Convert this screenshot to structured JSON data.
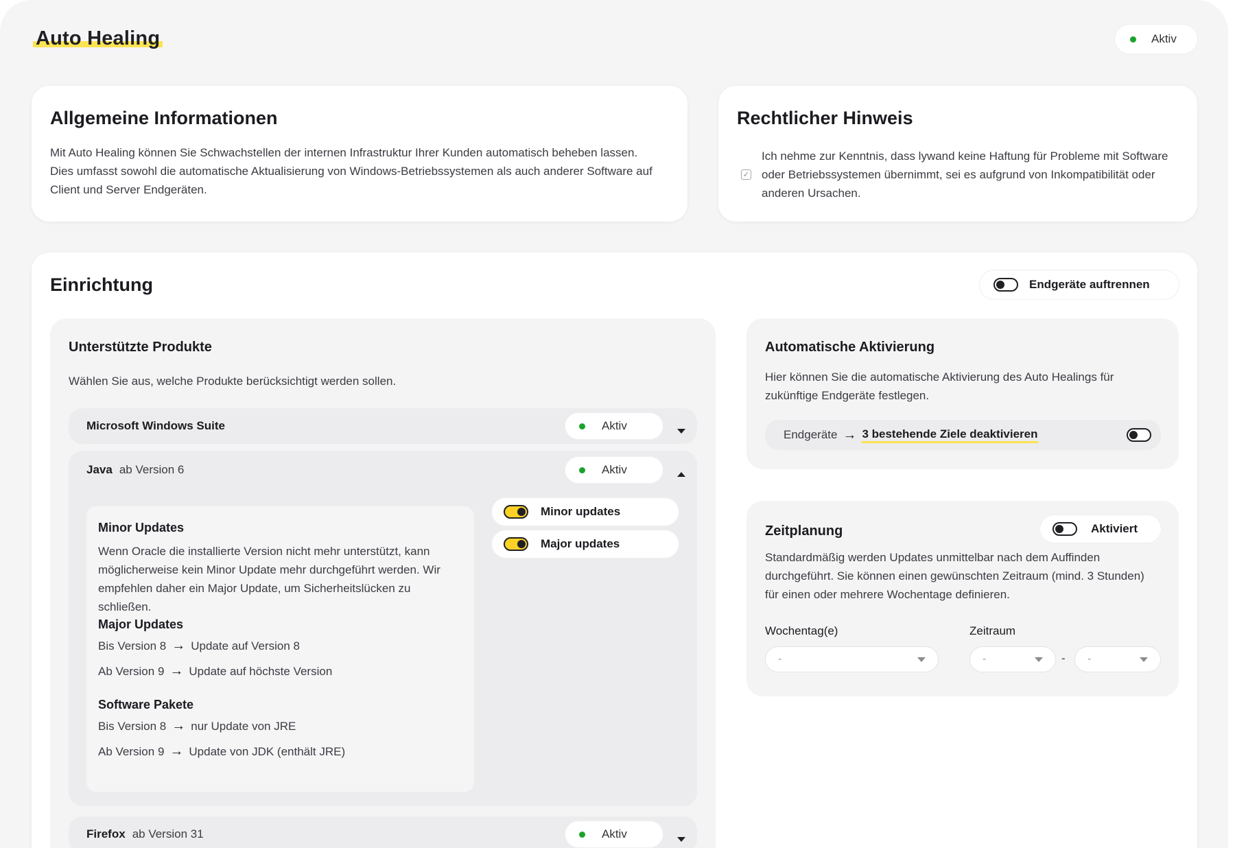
{
  "app": {
    "title": "Auto Healing",
    "status": "Aktiv",
    "status_color": "#1aa32c",
    "accent": "#fbd126"
  },
  "general": {
    "title": "Allgemeine Informationen",
    "text": "Mit Auto Healing können Sie Schwachstellen der internen Infrastruktur Ihrer Kunden automatisch beheben lassen. Dies umfasst sowohl die automatische Aktualisierung von Windows-Betriebssystemen als auch anderer Software auf Client und Server Endgeräten."
  },
  "legal": {
    "title": "Rechtlicher Hinweis",
    "checkbox_checked": true,
    "text": "Ich nehme zur Kenntnis, dass lywand keine Haftung für Probleme mit Software oder Betriebssystemen übernimmt, sei es aufgrund von Inkompatibilität oder anderen Ursachen."
  },
  "setup": {
    "title": "Einrichtung",
    "split_toggle_label": "Endgeräte auftrennen",
    "split_toggle_on": false
  },
  "products": {
    "title": "Unterstützte Produkte",
    "subtitle": "Wählen Sie aus, welche Produkte berücksichtigt werden sollen.",
    "items": [
      {
        "name": "Microsoft Windows Suite",
        "version": "",
        "status": "Aktiv",
        "expanded": false
      },
      {
        "name": "Java",
        "version": "ab Version 6",
        "status": "Aktiv",
        "expanded": true
      },
      {
        "name": "Firefox",
        "version": "ab Version 31",
        "status": "Aktiv",
        "expanded": false
      }
    ],
    "java_detail": {
      "minor_title": "Minor Updates",
      "minor_text": "Wenn Oracle die installierte Version nicht mehr unterstützt, kann möglicherweise kein Minor Update mehr durchgeführt werden. Wir empfehlen daher ein Major Update, um Sicherheitslücken zu schließen.",
      "major_title": "Major Updates",
      "major_lines": [
        {
          "from": "Bis Version 8",
          "to": "Update auf Version 8"
        },
        {
          "from": "Ab Version 9",
          "to": "Update auf höchste Version"
        }
      ],
      "packages_title": "Software Pakete",
      "package_lines": [
        {
          "from": "Bis Version 8",
          "to": "nur Update von JRE"
        },
        {
          "from": "Ab Version 9",
          "to": "Update von JDK (enthält JRE)"
        }
      ],
      "toggles": [
        {
          "label": "Minor updates",
          "on": true
        },
        {
          "label": "Major updates",
          "on": true
        }
      ]
    }
  },
  "auto_activation": {
    "title": "Automatische Aktivierung",
    "text": "Hier können Sie die automatische Aktivierung des Auto Healings für zukünftige Endgeräte festlegen.",
    "row_label": "Endgeräte",
    "row_link": "3 bestehende Ziele deaktivieren",
    "toggle_on": false
  },
  "schedule": {
    "title": "Zeitplanung",
    "toggle_label": "Aktiviert",
    "toggle_on": false,
    "text": "Standardmäßig werden Updates unmittelbar nach dem Auffinden durchgeführt. Sie können einen gewünschten Zeitraum (mind. 3 Stunden) für einen oder mehrere Wochentage definieren.",
    "weekday_label": "Wochentag(e)",
    "weekday_value": "-",
    "range_label": "Zeitraum",
    "range_from": "-",
    "range_separator": "-",
    "range_to": "-"
  }
}
